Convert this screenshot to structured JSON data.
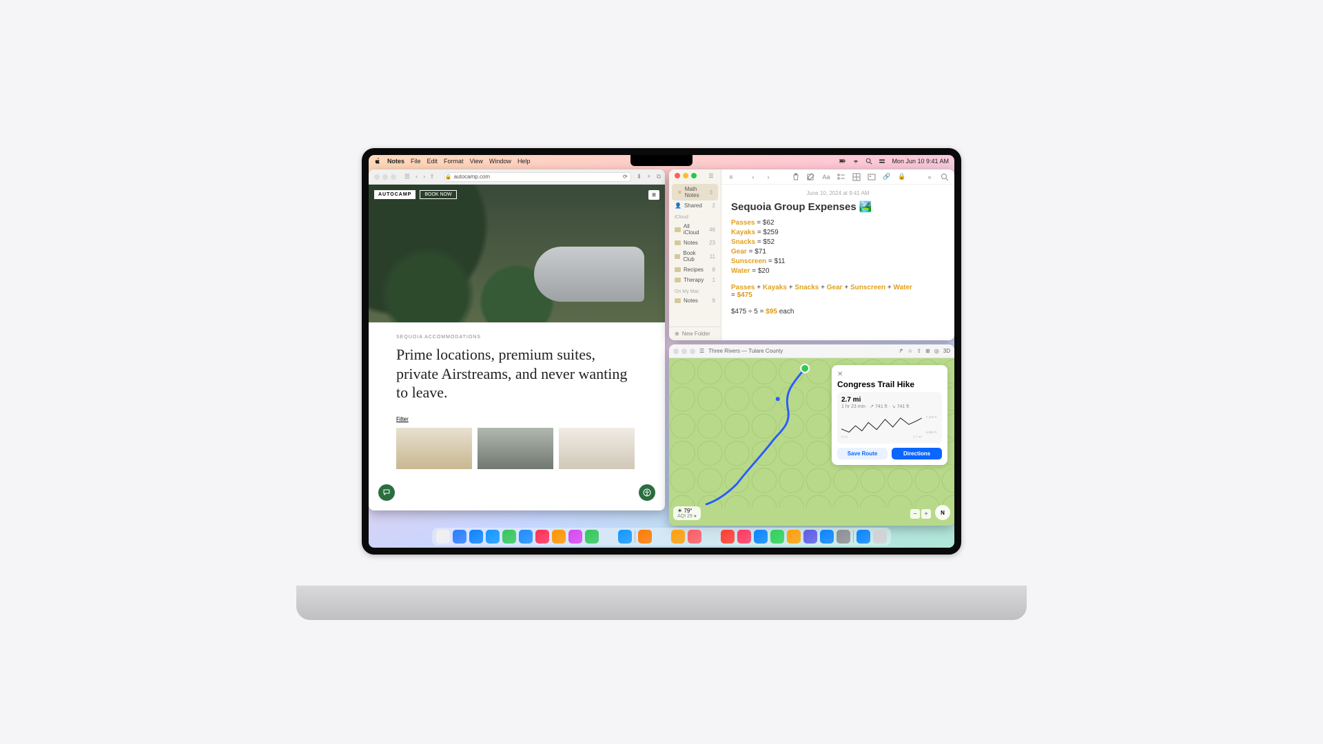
{
  "menubar": {
    "app": "Notes",
    "items": [
      "File",
      "Edit",
      "Format",
      "View",
      "Window",
      "Help"
    ],
    "datetime": "Mon Jun 10  9:41 AM"
  },
  "safari": {
    "url": "autocamp.com",
    "logo": "AUTOCAMP",
    "book": "BOOK NOW",
    "subhead": "SEQUOIA ACCOMMODATIONS",
    "headline": "Prime locations, premium suites, private Airstreams, and never wanting to leave.",
    "filter": "Filter"
  },
  "notes": {
    "sidebar": {
      "math_notes": {
        "label": "Math Notes",
        "count": "3"
      },
      "shared": {
        "label": "Shared",
        "count": "2"
      },
      "icloud_header": "iCloud",
      "folders": [
        {
          "label": "All iCloud",
          "count": "46"
        },
        {
          "label": "Notes",
          "count": "23"
        },
        {
          "label": "Book Club",
          "count": "11"
        },
        {
          "label": "Recipes",
          "count": "8"
        },
        {
          "label": "Therapy",
          "count": "1"
        }
      ],
      "onmac_header": "On My Mac",
      "onmac": {
        "label": "Notes",
        "count": "9"
      },
      "new_folder": "New Folder"
    },
    "note": {
      "date": "June 10, 2024 at 9:41 AM",
      "title": "Sequoia Group Expenses",
      "emoji": "🏞️",
      "lines": [
        {
          "term": "Passes",
          "val": "= $62"
        },
        {
          "term": "Kayaks",
          "val": "= $259"
        },
        {
          "term": "Snacks",
          "val": "= $52"
        },
        {
          "term": "Gear",
          "val": "= $71"
        },
        {
          "term": "Sunscreen",
          "val": "= $11"
        },
        {
          "term": "Water",
          "val": "= $20"
        }
      ],
      "sum_terms": [
        "Passes",
        "Kayaks",
        "Snacks",
        "Gear",
        "Sunscreen",
        "Water"
      ],
      "sum_result": "$475",
      "divide_pre": "$475 ÷ 5 = ",
      "divide_result": "$95",
      "divide_post": " each"
    }
  },
  "maps": {
    "location": "Three Rivers — Tulare County",
    "card": {
      "title": "Congress Trail Hike",
      "distance": "2.7 mi",
      "duration": "1 hr 23 min",
      "ascent": "741 ft",
      "descent": "741 ft",
      "save": "Save Route",
      "directions": "Directions"
    },
    "weather": {
      "temp": "79°",
      "aqi": "AQI 29"
    },
    "compass": "N",
    "elev": {
      "xmin": "0 mi",
      "xmax": "2.7 mi",
      "ymax": "7,100 ft",
      "ymin": "6,800 ft"
    }
  },
  "dock_colors": [
    "#f0f0f0",
    "#2a7eff",
    "#0b84ff",
    "#1296ff",
    "#34c759",
    "#1c8cff",
    "#ff2d55",
    "#ff9500",
    "#d946ef",
    "#34c759",
    "#fff",
    "#1296ff",
    "#ff7a00",
    "#fff",
    "#ff9f0a",
    "#fc5c65",
    "#000",
    "#ff3b30",
    "#ff375f",
    "#0a84ff",
    "#30d158",
    "#ff9f0a",
    "#5e5ce6",
    "#0a84ff",
    "#8e8e93",
    "#0a84ff",
    "#d1d1d6"
  ]
}
